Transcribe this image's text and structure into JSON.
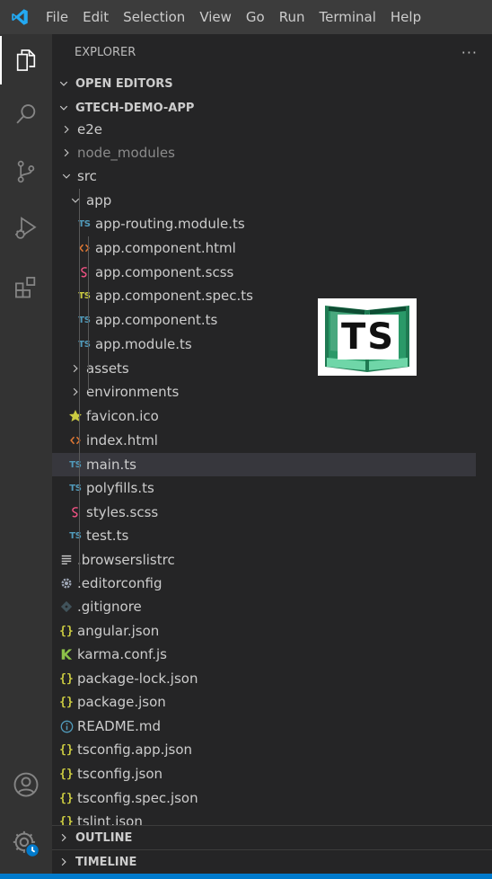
{
  "colors": {
    "titlebar_bg": "#3c3c3c",
    "activitybar_bg": "#333333",
    "sidebar_bg": "#252526",
    "selection_bg": "#37373d",
    "accent_blue": "#007acc",
    "ts_blue": "#519aba",
    "ts_yellow": "#cbcb41",
    "html_orange": "#e37933",
    "scss_pink": "#f55385",
    "json_yellow": "#cbcb41",
    "logo_green": "#1a7a4a"
  },
  "menu": [
    "File",
    "Edit",
    "Selection",
    "View",
    "Go",
    "Run",
    "Terminal",
    "Help"
  ],
  "activity_icons": [
    "explorer-icon",
    "search-icon",
    "source-control-icon",
    "run-debug-icon",
    "extensions-icon",
    "account-icon",
    "settings-gear-icon"
  ],
  "explorer": {
    "title": "EXPLORER",
    "more": "···",
    "open_editors": "OPEN EDITORS",
    "project": "GTECH-DEMO-APP",
    "outline": "OUTLINE",
    "timeline": "TIMELINE"
  },
  "tree": [
    {
      "label": "e2e",
      "type": "folder",
      "depth": 1,
      "expanded": false
    },
    {
      "label": "node_modules",
      "type": "folder",
      "depth": 1,
      "expanded": false,
      "dim": true
    },
    {
      "label": "src",
      "type": "folder",
      "depth": 1,
      "expanded": true
    },
    {
      "label": "app",
      "type": "folder",
      "depth": 2,
      "expanded": true
    },
    {
      "label": "app-routing.module.ts",
      "type": "ts",
      "depth": 3
    },
    {
      "label": "app.component.html",
      "type": "html",
      "depth": 3
    },
    {
      "label": "app.component.scss",
      "type": "scss",
      "depth": 3
    },
    {
      "label": "app.component.spec.ts",
      "type": "ts-spec",
      "depth": 3
    },
    {
      "label": "app.component.ts",
      "type": "ts",
      "depth": 3
    },
    {
      "label": "app.module.ts",
      "type": "ts",
      "depth": 3
    },
    {
      "label": "assets",
      "type": "folder",
      "depth": 2,
      "expanded": false
    },
    {
      "label": "environments",
      "type": "folder",
      "depth": 2,
      "expanded": false
    },
    {
      "label": "favicon.ico",
      "type": "favicon",
      "depth": 2
    },
    {
      "label": "index.html",
      "type": "html",
      "depth": 2
    },
    {
      "label": "main.ts",
      "type": "ts",
      "depth": 2,
      "selected": true
    },
    {
      "label": "polyfills.ts",
      "type": "ts",
      "depth": 2
    },
    {
      "label": "styles.scss",
      "type": "scss",
      "depth": 2
    },
    {
      "label": "test.ts",
      "type": "ts",
      "depth": 2
    },
    {
      "label": ".browserslistrc",
      "type": "lines",
      "depth": 1
    },
    {
      "label": ".editorconfig",
      "type": "gear",
      "depth": 1
    },
    {
      "label": ".gitignore",
      "type": "git",
      "depth": 1
    },
    {
      "label": "angular.json",
      "type": "json",
      "depth": 1
    },
    {
      "label": "karma.conf.js",
      "type": "karma",
      "depth": 1
    },
    {
      "label": "package-lock.json",
      "type": "json",
      "depth": 1
    },
    {
      "label": "package.json",
      "type": "json",
      "depth": 1
    },
    {
      "label": "README.md",
      "type": "info",
      "depth": 1
    },
    {
      "label": "tsconfig.app.json",
      "type": "json",
      "depth": 1
    },
    {
      "label": "tsconfig.json",
      "type": "json",
      "depth": 1
    },
    {
      "label": "tsconfig.spec.json",
      "type": "json",
      "depth": 1
    },
    {
      "label": "tslint.json",
      "type": "json",
      "depth": 1
    }
  ],
  "ts_logo_text": "TS"
}
